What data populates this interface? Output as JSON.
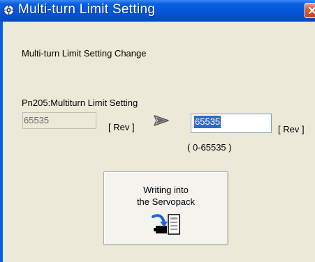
{
  "window": {
    "title": "Multi-turn Limit Setting",
    "app_icon": "gear-icon",
    "close_icon": "close-icon"
  },
  "content": {
    "heading": "Multi-turn Limit Setting Change",
    "param_label": "Pn205:Multiturn Limit Setting",
    "current_value": "65535",
    "current_unit": "[ Rev ]",
    "arrow_icon": "arrow-right-icon",
    "new_value": "65535",
    "new_unit": "[ Rev ]",
    "range": "( 0-65535 )"
  },
  "write_button": {
    "line1": "Writing into",
    "line2": "the Servopack",
    "icon": "write-to-servopack-icon"
  },
  "colors": {
    "titlebar": "#0454d6",
    "window_bg": "#ece9d8",
    "selection": "#316ac5",
    "close": "#e0582c"
  }
}
